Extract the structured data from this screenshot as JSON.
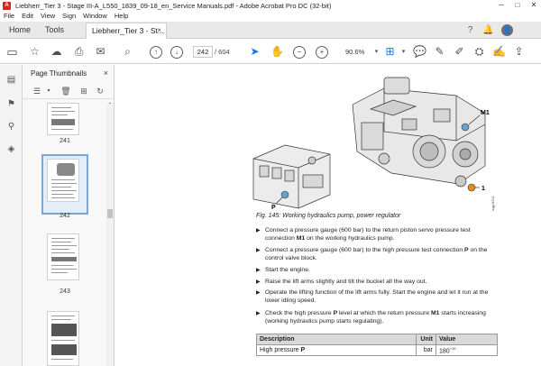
{
  "window": {
    "app_icon": "A",
    "title": "Liebherr_Tier 3 - Stage III-A_L550_1839_09-18_en_Service Manuals.pdf - Adobe Acrobat Pro DC (32-bit)",
    "minimize": "─",
    "maximize": "□",
    "close": "✕"
  },
  "menu": [
    "File",
    "Edit",
    "View",
    "Sign",
    "Window",
    "Help"
  ],
  "tabs": {
    "home": "Home",
    "tools": "Tools",
    "document": "Liebherr_Tier 3 - St...",
    "close": "×"
  },
  "toolbar": {
    "current_page": "242",
    "total_pages": "/ 604",
    "zoom": "90.6%"
  },
  "panel": {
    "title": "Page Thumbnails",
    "close": "×",
    "thumbnails": [
      {
        "label": "241"
      },
      {
        "label": "242",
        "selected": true
      },
      {
        "label": "243"
      },
      {
        "label": ""
      }
    ]
  },
  "document": {
    "labels": {
      "p": "P",
      "m1": "M1",
      "one": "1",
      "code": "wgp0010"
    },
    "caption": "Fig. 145: Working hydraulics pump, power regulator",
    "bullets": [
      {
        "parts": [
          "Connect a pressure gauge (600 bar) to the return piston servo pressure test connection ",
          "M1",
          " on the working hydraulics pump."
        ]
      },
      {
        "parts": [
          "Connect a pressure gauge (600 bar) to the high pressure test connection ",
          "P",
          " on the control valve block."
        ]
      },
      {
        "parts": [
          "Start the engine.",
          "",
          ""
        ]
      },
      {
        "parts": [
          "Raise the lift arms slightly and tilt the bucket all the way out.",
          "",
          ""
        ]
      },
      {
        "parts": [
          "Operate the lifting function of the lift arms fully. Start the engine and let it run at the lower idling speed.",
          "",
          ""
        ]
      },
      {
        "parts": [
          "Check the high pressure ",
          "P",
          " level at which the return pressure ",
          "M1",
          " starts increasing (working hydraulics pump starts regulating)."
        ]
      }
    ],
    "table": {
      "headers": [
        "Description",
        "Unit",
        "Value"
      ],
      "row": {
        "desc_prefix": "High pressure ",
        "desc_bold": "P",
        "unit": "bar",
        "value": "180",
        "value_sup": "+10"
      }
    }
  },
  "icons": [
    "home-icon",
    "star-icon",
    "cloud-upload-icon",
    "print-icon",
    "search-icon",
    "page-up-icon",
    "page-down-icon",
    "pointer-icon",
    "hand-icon",
    "zoom-out-icon",
    "zoom-in-icon",
    "fit-page-icon",
    "thumbnails-icon",
    "bookmark-icon",
    "attachment-icon",
    "layers-icon",
    "options-icon",
    "delete-icon",
    "insert-icon",
    "rotate-icon"
  ]
}
